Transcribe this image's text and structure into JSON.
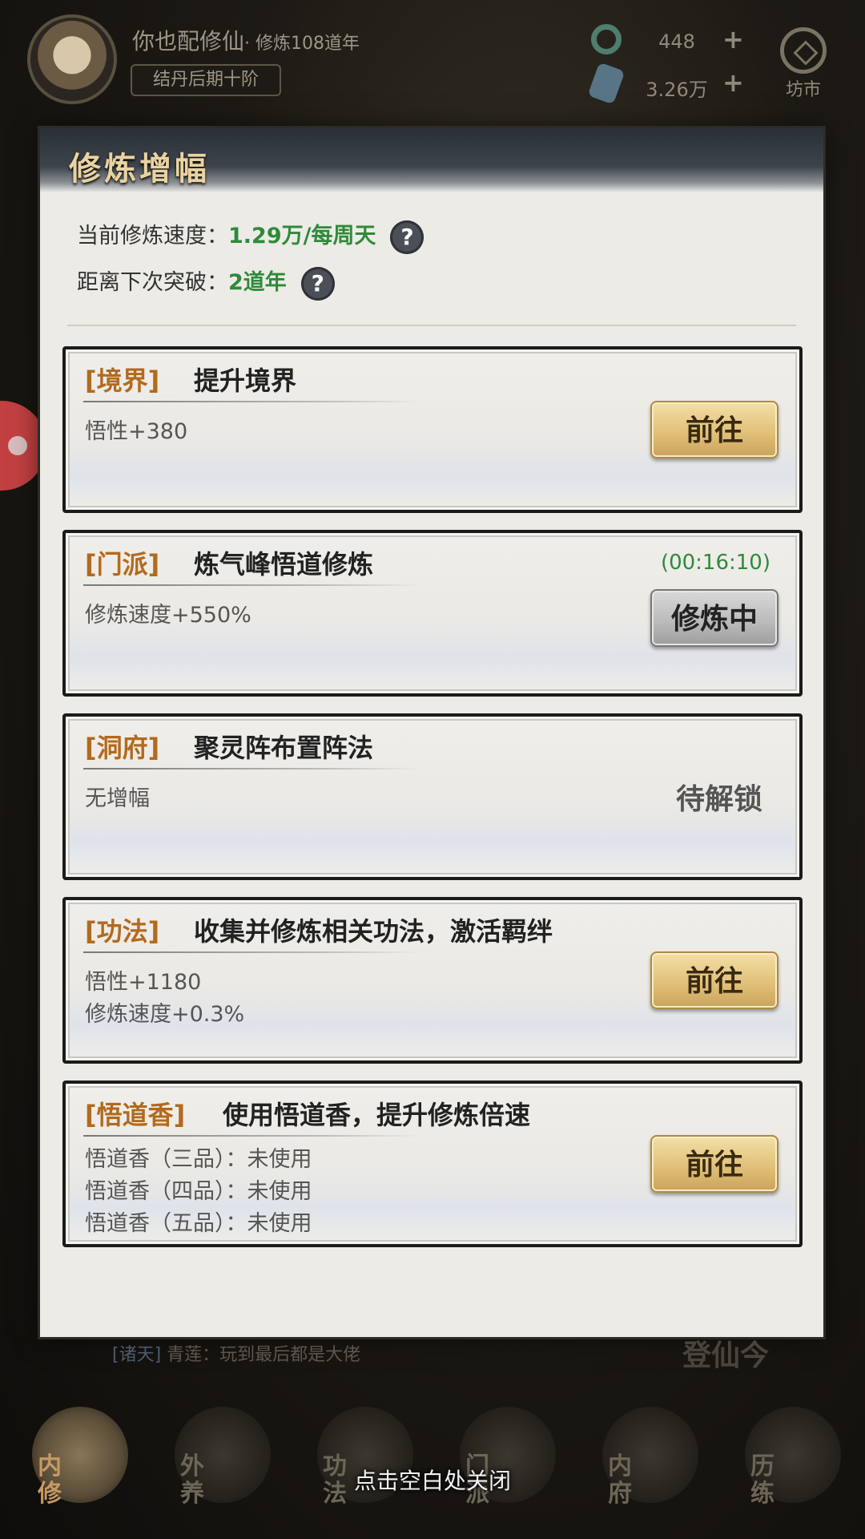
{
  "player": {
    "name": "你也配修仙",
    "subtitle": "· 修炼108道年",
    "rank": "结丹后期十阶"
  },
  "currency": {
    "jade_amount": "448",
    "stone_amount": "3.26万",
    "plus": "+"
  },
  "market": {
    "label": "坊市"
  },
  "dialog": {
    "title": "修炼增幅",
    "speed_label": "当前修炼速度：",
    "speed_value": "1.29万/每周天",
    "breakthrough_label": "距离下次突破：",
    "breakthrough_value": "2道年",
    "help_glyph": "?",
    "cards": [
      {
        "tag": "[境界]",
        "name": "提升境界",
        "effects": [
          "悟性+380"
        ],
        "button": "前往",
        "state": "go"
      },
      {
        "tag": "[门派]",
        "name": "炼气峰悟道修炼",
        "effects": [
          "修炼速度+550%"
        ],
        "timer": "(00:16:10)",
        "button": "修炼中",
        "state": "busy"
      },
      {
        "tag": "[洞府]",
        "name": "聚灵阵布置阵法",
        "effects": [
          "无增幅"
        ],
        "status": "待解锁",
        "state": "locked"
      },
      {
        "tag": "[功法]",
        "name": "收集并修炼相关功法，激活羁绊",
        "effects": [
          "悟性+1180",
          "修炼速度+0.3%"
        ],
        "button": "前往",
        "state": "go"
      },
      {
        "tag": "[悟道香]",
        "name": "使用悟道香，提升修炼倍速",
        "effects": [
          "悟道香（三品）：未使用",
          "悟道香（四品）：未使用",
          "悟道香（五品）：未使用"
        ],
        "button": "前往",
        "state": "go"
      }
    ]
  },
  "chat": {
    "channel": "[诸天]",
    "message": "青莲：玩到最后都是大佬"
  },
  "background_text": "登仙今",
  "bottom_nav": [
    {
      "label": "内修",
      "active": true
    },
    {
      "label": "外养",
      "active": false
    },
    {
      "label": "功法",
      "active": false
    },
    {
      "label": "门派",
      "active": false
    },
    {
      "label": "内府",
      "active": false
    },
    {
      "label": "历练",
      "active": false
    }
  ],
  "close_hint": "点击空白处关闭",
  "colors": {
    "accent_green": "#2f8a3a",
    "tag_orange": "#b26a1e",
    "button_gold": "#e1c17a"
  }
}
